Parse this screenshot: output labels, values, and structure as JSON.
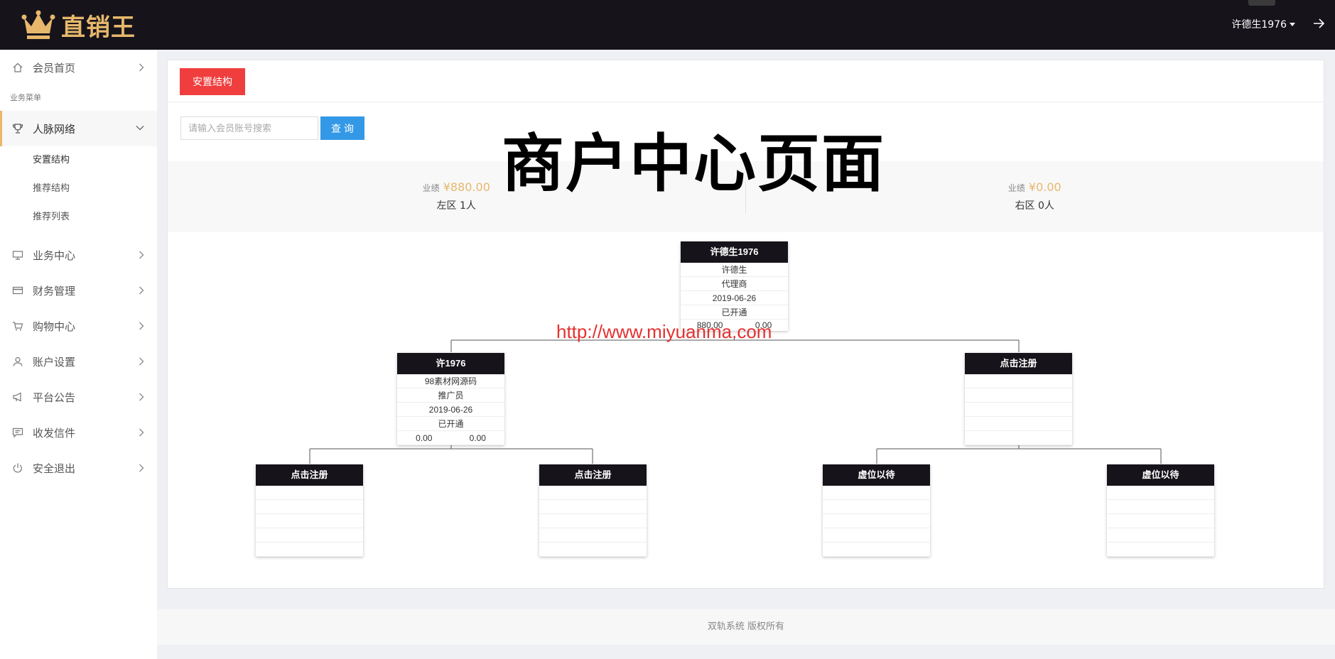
{
  "brand": {
    "name": "直销王"
  },
  "header": {
    "username": "许德生1976"
  },
  "sidebar": {
    "home": "会员首页",
    "section": "业务菜单",
    "network": "人脉网络",
    "network_sub": [
      "安置结构",
      "推荐结构",
      "推荐列表"
    ],
    "items": [
      "业务中心",
      "财务管理",
      "购物中心",
      "账户设置",
      "平台公告",
      "收发信件",
      "安全退出"
    ]
  },
  "main": {
    "tab_label": "安置结构",
    "search_placeholder": "请输入会员账号搜索",
    "search_button": "查 询",
    "left": {
      "perf_label": "业绩",
      "perf_value": "¥880.00",
      "zone": "左区 1人"
    },
    "right": {
      "perf_label": "业绩",
      "perf_value": "¥0.00",
      "zone": "右区 0人"
    }
  },
  "tree": {
    "root": {
      "title": "许德生1976",
      "rows": [
        "许德生",
        "代理商",
        "2019-06-26",
        "已开通"
      ],
      "left_amount": "880.00",
      "right_amount": "0.00"
    },
    "l": {
      "title": "许1976",
      "rows": [
        "98素材网源码",
        "推广员",
        "2019-06-26",
        "已开通"
      ],
      "left_amount": "0.00",
      "right_amount": "0.00"
    },
    "r": {
      "title": "点击注册"
    },
    "ll": {
      "title": "点击注册"
    },
    "lr": {
      "title": "点击注册"
    },
    "rl": {
      "title": "虚位以待"
    },
    "rr": {
      "title": "虚位以待"
    }
  },
  "overlay": {
    "title": "商户中心页面",
    "watermark": "http://www.miyuanma.com"
  },
  "footer": {
    "text": "双轨系统 版权所有"
  },
  "colors": {
    "topbar": "#16131a",
    "brand_gold": "#e7b86c",
    "tab_red": "#f03e3e",
    "search_blue": "#3399e6",
    "watermark_red": "#e53030"
  }
}
